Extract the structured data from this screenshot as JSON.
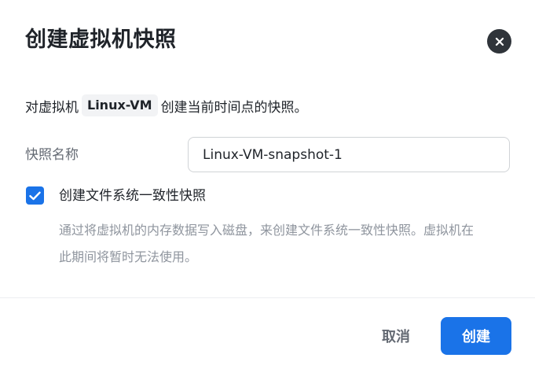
{
  "dialog": {
    "title": "创建虚拟机快照",
    "close_icon": "close-icon"
  },
  "description": {
    "prefix": "对虚拟机",
    "vm_name": "Linux-VM",
    "suffix": "创建当前时间点的快照。"
  },
  "snapshot_name": {
    "label": "快照名称",
    "value": "Linux-VM-snapshot-1"
  },
  "consistency": {
    "checked": true,
    "label": "创建文件系统一致性快照",
    "hint": "通过将虚拟机的内存数据写入磁盘，来创建文件系统一致性快照。虚拟机在此期间将暂时无法使用。"
  },
  "footer": {
    "cancel_label": "取消",
    "create_label": "创建"
  },
  "colors": {
    "primary": "#1a73e8",
    "close_bg": "#2f343a",
    "hint_text": "#8f959e"
  }
}
